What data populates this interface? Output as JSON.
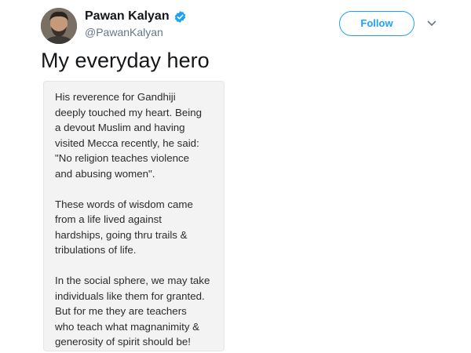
{
  "user": {
    "display_name": "Pawan Kalyan",
    "handle": "@PawanKalyan",
    "avatar_icon": "avatar-photo",
    "verified_icon": "verified-badge-icon",
    "verified_color": "#1da1f2"
  },
  "actions": {
    "follow_label": "Follow",
    "more_icon": "chevron-down-icon"
  },
  "tweet": {
    "text": "My everyday hero"
  },
  "image_text": {
    "paragraphs": [
      [
        "His reverence for Gandhiji",
        "deeply touched  my heart. Being",
        "a devout Muslim and having",
        "visited Mecca recently, he said:",
        "\"No religion teaches violence",
        "and abusing women\"."
      ],
      [
        "These words of wisdom came",
        "from a life lived against",
        "hardships, going thru trails &",
        "tribulations of life."
      ],
      [
        "In the social sphere, we may take",
        "individuals like them for granted.",
        "But for me they  are teachers",
        "who teach what magnanimity &",
        "generosity of spirit should be!"
      ]
    ]
  },
  "colors": {
    "accent": "#1da1f2",
    "secondary_text": "#657786",
    "card_background": "#f3f3f3"
  }
}
